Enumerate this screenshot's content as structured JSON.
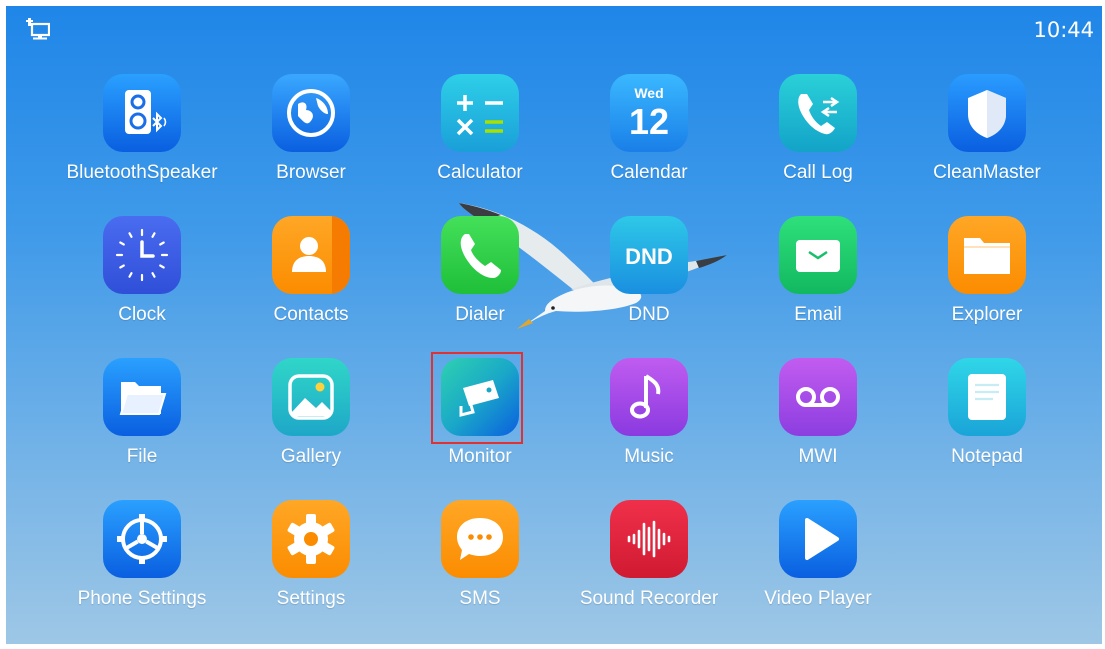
{
  "status_bar": {
    "time": "10:44",
    "network_icon": "ethernet-icon"
  },
  "apps": [
    {
      "label": "BluetoothSpeaker",
      "icon": "bluetooth-speaker-icon"
    },
    {
      "label": "Browser",
      "icon": "globe-icon"
    },
    {
      "label": "Calculator",
      "icon": "calculator-icon"
    },
    {
      "label": "Calendar",
      "icon": "calendar-icon",
      "day": "Wed",
      "date": "12"
    },
    {
      "label": "Call Log",
      "icon": "call-log-icon"
    },
    {
      "label": "CleanMaster",
      "icon": "shield-icon"
    },
    {
      "label": "Clock",
      "icon": "clock-icon"
    },
    {
      "label": "Contacts",
      "icon": "contacts-icon"
    },
    {
      "label": "Dialer",
      "icon": "phone-icon"
    },
    {
      "label": "DND",
      "icon": "dnd-icon",
      "badge": "DND"
    },
    {
      "label": "Email",
      "icon": "envelope-icon"
    },
    {
      "label": "Explorer",
      "icon": "folder-icon"
    },
    {
      "label": "File",
      "icon": "file-folder-icon"
    },
    {
      "label": "Gallery",
      "icon": "gallery-icon"
    },
    {
      "label": "Monitor",
      "icon": "security-camera-icon",
      "highlighted": true
    },
    {
      "label": "Music",
      "icon": "music-note-icon"
    },
    {
      "label": "MWI",
      "icon": "voicemail-icon"
    },
    {
      "label": "Notepad",
      "icon": "notepad-icon"
    },
    {
      "label": "Phone Settings",
      "icon": "steering-gear-icon"
    },
    {
      "label": "Settings",
      "icon": "gear-icon"
    },
    {
      "label": "SMS",
      "icon": "chat-bubble-icon"
    },
    {
      "label": "Sound Recorder",
      "icon": "sound-wave-icon"
    },
    {
      "label": "Video Player",
      "icon": "play-icon"
    }
  ],
  "wallpaper": {
    "subject": "seagull",
    "colors": [
      "#1f86e8",
      "#9ec7e6"
    ]
  },
  "highlight_color": "#e03232"
}
